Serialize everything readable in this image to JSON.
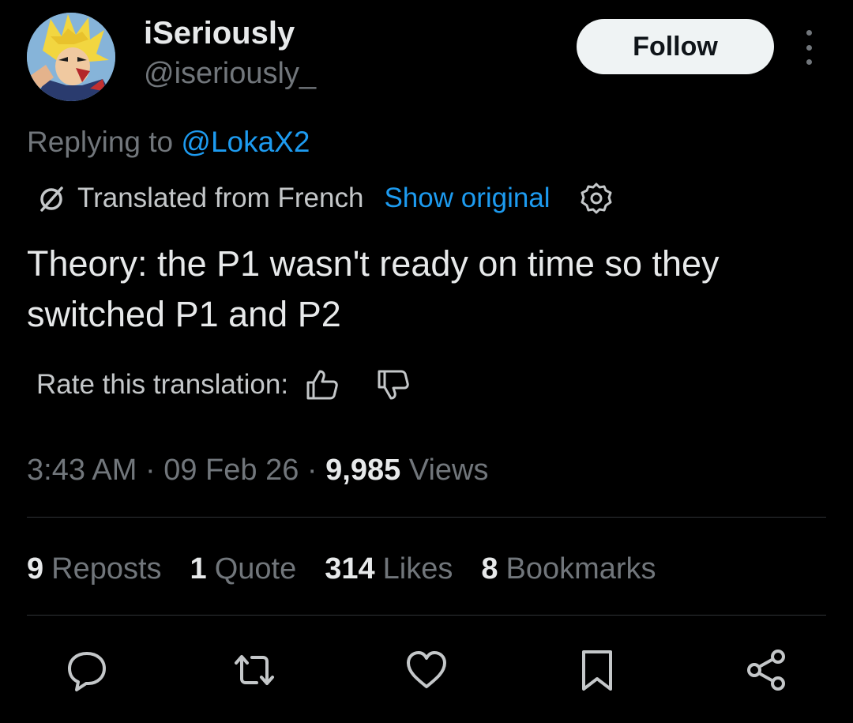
{
  "author": {
    "display_name": "iSeriously",
    "handle": "@iseriously_",
    "avatar_icon": "avatar-anime-character"
  },
  "follow_label": "Follow",
  "reply": {
    "prefix": "Replying to ",
    "mention": "@LokaX2"
  },
  "translation": {
    "label": "Translated from French",
    "show_original": "Show original"
  },
  "tweet_text": "Theory: the P1 wasn't ready on time so they switched P1 and P2",
  "rate": {
    "label": "Rate this translation:"
  },
  "meta": {
    "time": "3:43 AM",
    "sep1": " · ",
    "date": "09 Feb 26",
    "sep2": " · ",
    "views_count": "9,985",
    "views_label": "Views"
  },
  "stats": {
    "reposts_count": "9",
    "reposts_label": "Reposts",
    "quote_count": "1",
    "quote_label": "Quote",
    "likes_count": "314",
    "likes_label": "Likes",
    "bookmarks_count": "8",
    "bookmarks_label": "Bookmarks"
  },
  "colors": {
    "background": "#000000",
    "text": "#e7e9ea",
    "secondary": "#71767b",
    "link": "#1d9bf0",
    "divider": "#2f3336",
    "follow_bg": "#eff3f4"
  }
}
